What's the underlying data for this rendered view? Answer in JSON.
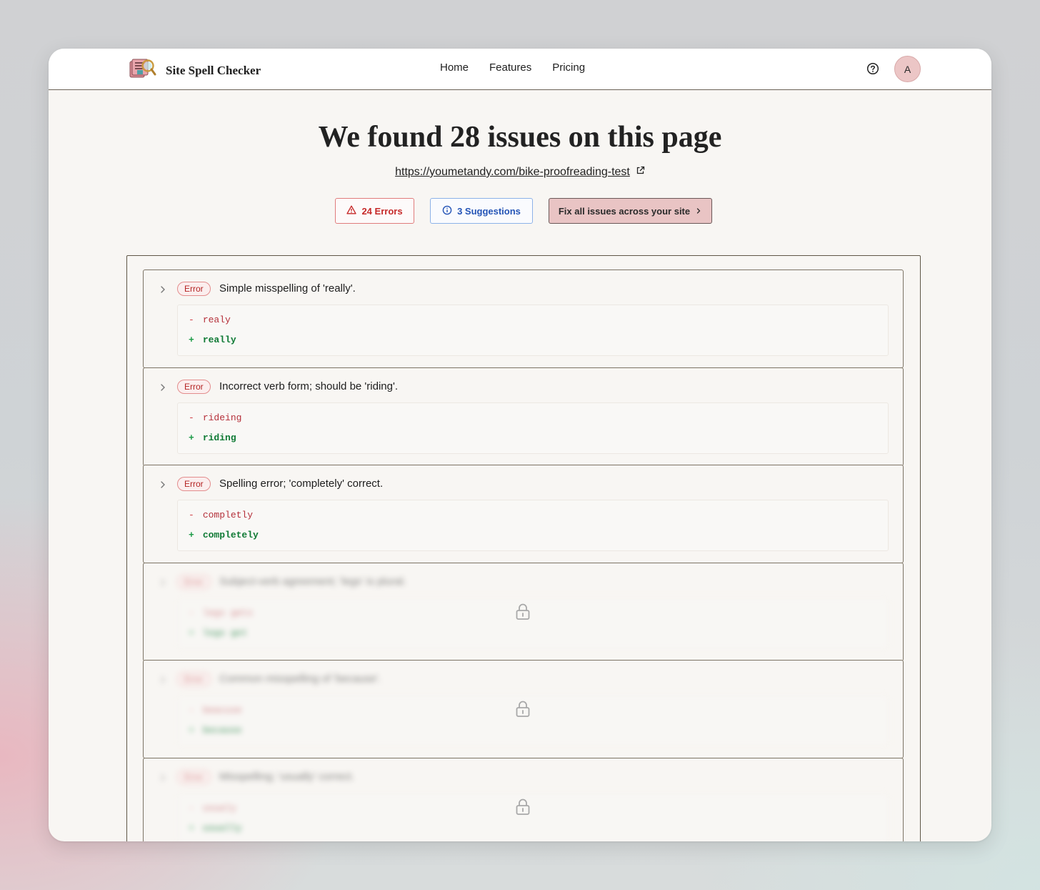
{
  "app": {
    "name": "Site Spell Checker"
  },
  "nav": {
    "items": [
      "Home",
      "Features",
      "Pricing"
    ]
  },
  "user": {
    "avatar_initial": "A"
  },
  "header": {
    "title": "We found 28 issues on this page",
    "url": "https://youmetandy.com/bike-proofreading-test"
  },
  "summary": {
    "errors_label": "24 Errors",
    "suggestions_label": "3 Suggestions",
    "fix_label": "Fix all issues across your site"
  },
  "issues": [
    {
      "type": "Error",
      "message": "Simple misspelling of 'really'.",
      "removed": "realy",
      "added": "really",
      "locked": false
    },
    {
      "type": "Error",
      "message": "Incorrect verb form; should be 'riding'.",
      "removed": "rideing",
      "added": "riding",
      "locked": false
    },
    {
      "type": "Error",
      "message": "Spelling error; 'completely' correct.",
      "removed": "completly",
      "added": "completely",
      "locked": false
    },
    {
      "type": "Error",
      "message": "Subject-verb agreement; 'legs' is plural.",
      "removed": "legs gets",
      "added": "legs get",
      "locked": true
    },
    {
      "type": "Error",
      "message": "Common misspelling of 'because'.",
      "removed": "beacuse",
      "added": "because",
      "locked": true
    },
    {
      "type": "Error",
      "message": "Misspelling; 'usually' correct.",
      "removed": "usualy",
      "added": "usually",
      "locked": true
    }
  ],
  "colors": {
    "error": "#c62a2a",
    "suggestion": "#2454b6",
    "fix_button_bg": "#e9c4c4",
    "added": "#0f7a35",
    "removed": "#b5303a"
  }
}
